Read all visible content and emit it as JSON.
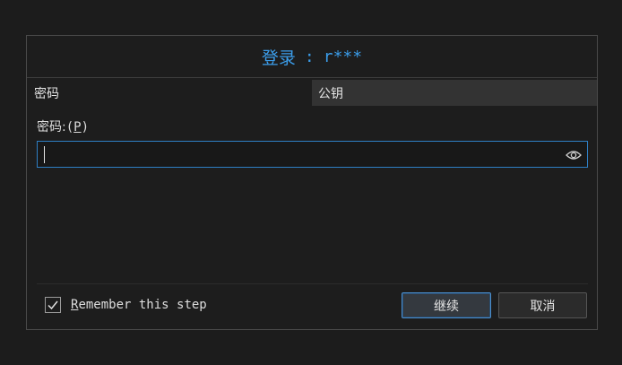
{
  "title": {
    "prefix": "登录",
    "separator": ":",
    "user": "r***"
  },
  "tabs": [
    {
      "label": "密码",
      "active": true
    },
    {
      "label": "公钥",
      "active": false
    }
  ],
  "password_field": {
    "label_prefix": "密码:",
    "label_open": "(",
    "label_mnemonic": "P",
    "label_close": ")",
    "value": ""
  },
  "remember": {
    "checked": true,
    "label_first": "R",
    "label_rest": "emember this step"
  },
  "buttons": {
    "continue": "继续",
    "cancel": "取消"
  },
  "colors": {
    "accent": "#3b9dea",
    "background": "#1d1d1d",
    "inactive_tab": "#333333"
  }
}
